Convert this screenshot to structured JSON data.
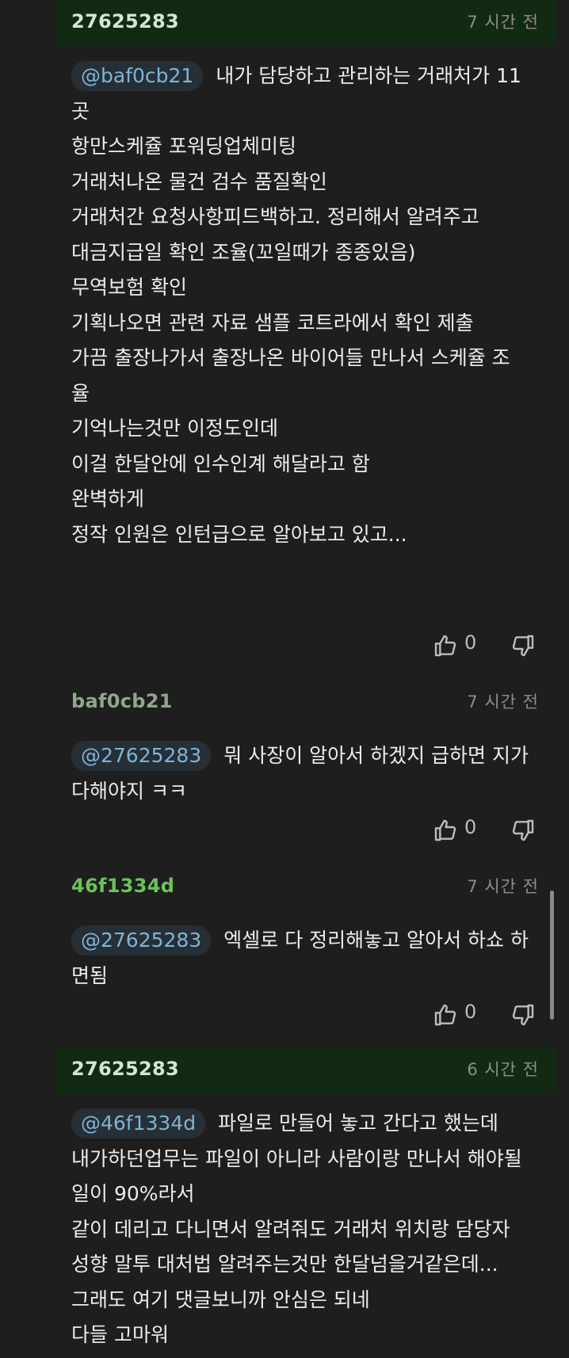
{
  "colors": {
    "background": "#1e1e1e",
    "op_header": "#132a12",
    "mention_text": "#7eb4d6",
    "mention_bg": "#262f36"
  },
  "comments": [
    {
      "author": "27625283",
      "author_color": "#d3e6cf",
      "time": "7 시간 전",
      "mention": "@baf0cb21",
      "lines": [
        "내가 담당하고 관리하는 거래처가 11",
        "곳",
        "항만스케쥴 포워딩업체미팅",
        "거래처나온 물건 검수 품질확인",
        "거래처간 요청사항피드백하고. 정리해서 알려주고",
        "대금지급일 확인 조율(꼬일때가 종종있음)",
        "무역보험 확인",
        "기획나오면 관련 자료 샘플 코트라에서 확인 제출",
        "가끔 출장나가서 출장나온 바이어들 만나서 스케쥴 조",
        "율",
        "",
        "기억나는것만 이정도인데",
        "",
        "이걸 한달안에 인수인계 해달라고 함",
        "완벽하게",
        "정작 인원은 인턴급으로 알아보고 있고..."
      ],
      "likes": "0"
    },
    {
      "author": "baf0cb21",
      "author_color": "#8fa88c",
      "time": "7 시간 전",
      "mention": "@27625283",
      "lines": [
        "뭐 사장이 알아서 하겠지 급하면 지가",
        "다해야지 ㅋㅋ"
      ],
      "likes": "0"
    },
    {
      "author": "46f1334d",
      "author_color": "#6cc25a",
      "time": "7 시간 전",
      "mention": "@27625283",
      "lines": [
        "엑셀로 다 정리해놓고 알아서 하쇼 하",
        "면됨"
      ],
      "likes": "0"
    },
    {
      "author": "27625283",
      "author_color": "#d3e6cf",
      "time": "6 시간 전",
      "mention": "@46f1334d",
      "lines": [
        "파일로 만들어 놓고 간다고 했는데",
        "내가하던업무는 파일이 아니라 사람이랑 만나서 해야될",
        "일이 90%라서",
        "같이 데리고 다니면서 알려줘도 거래처 위치랑 담당자",
        "성향 말투 대처법 알려주는것만 한달넘을거같은데...",
        "그래도 여기 댓글보니까 안심은 되네",
        "다들 고마워"
      ],
      "likes": ""
    }
  ]
}
